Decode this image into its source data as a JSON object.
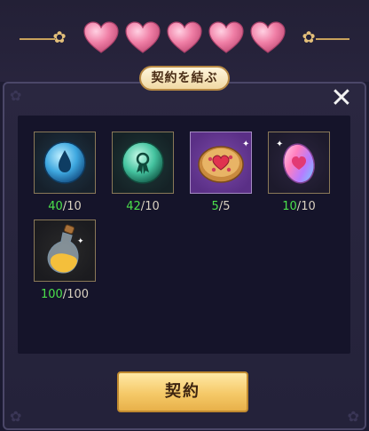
{
  "header": {
    "hearts_count": 5,
    "heart_color": "#f07fa6",
    "title": "契約を結ぶ"
  },
  "items": [
    {
      "icon": "water-drop-orb-icon",
      "have": "40",
      "sep": "/",
      "need": "10"
    },
    {
      "icon": "ribbon-medal-orb-icon",
      "have": "42",
      "sep": "/",
      "need": "10"
    },
    {
      "icon": "heart-cookie-icon",
      "have": "5",
      "sep": "/",
      "need": "5"
    },
    {
      "icon": "rainbow-heart-gem-icon",
      "have": "10",
      "sep": "/",
      "need": "10"
    },
    {
      "icon": "golden-potion-bottle-icon",
      "have": "100",
      "sep": "/",
      "need": "100"
    }
  ],
  "close_symbol": "✕",
  "confirm_label": "契約",
  "colors": {
    "have_green": "#4be04b",
    "gold_accent": "#c8a25c",
    "panel_bg": "#2a2740",
    "inner_bg": "#15142a",
    "button_gold": "#f5c968"
  }
}
